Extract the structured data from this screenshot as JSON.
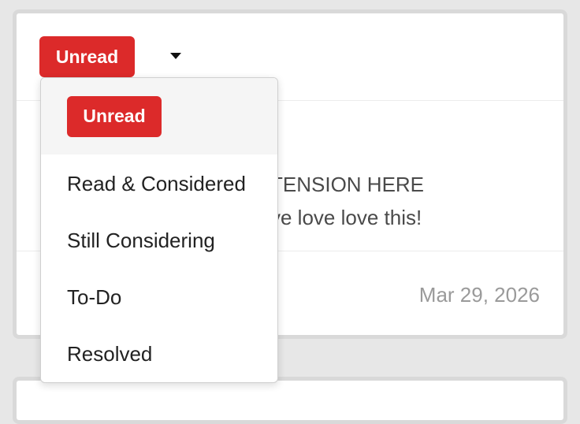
{
  "status": {
    "current_label": "Unread",
    "accent_color": "#dc2a2a"
  },
  "caret": {
    "icon": "caret-down-icon"
  },
  "feedback": {
    "title_fragment": "TENSION HERE",
    "text_fragment": "ve love love this!",
    "date": "Mar 29, 2026"
  },
  "dropdown": {
    "options": [
      {
        "label": "Unread"
      },
      {
        "label": "Read & Considered"
      },
      {
        "label": "Still Considering"
      },
      {
        "label": "To-Do"
      },
      {
        "label": "Resolved"
      }
    ]
  }
}
